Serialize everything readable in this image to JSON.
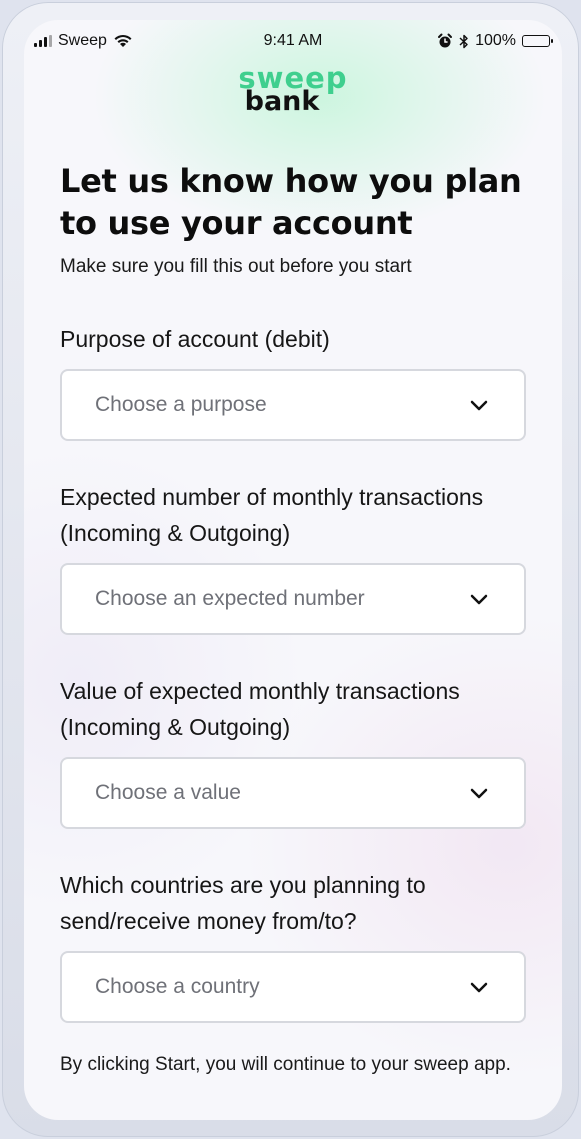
{
  "status_bar": {
    "carrier": "Sweep",
    "time": "9:41 AM",
    "battery": "100%",
    "icons": [
      "signal-icon",
      "wifi-icon",
      "alarm-icon",
      "bluetooth-icon",
      "battery-icon"
    ]
  },
  "logo": {
    "line1": "sweep",
    "line2": "bank",
    "brand_color": "#3fcf8e"
  },
  "heading": "Let us know how you plan to use your account",
  "subtitle": "Make sure you fill this out before you start",
  "fields": [
    {
      "label": "Purpose of account (debit)",
      "placeholder": "Choose a purpose"
    },
    {
      "label": "Expected number of monthly transactions (Incoming & Outgoing)",
      "placeholder": "Choose an expected number"
    },
    {
      "label": "Value of expected monthly transactions (Incoming & Outgoing)",
      "placeholder": "Choose a value"
    },
    {
      "label": "Which countries are you planning to send/receive money from/to?",
      "placeholder": "Choose a country"
    }
  ],
  "footer": "By clicking Start, you will continue to your sweep app."
}
